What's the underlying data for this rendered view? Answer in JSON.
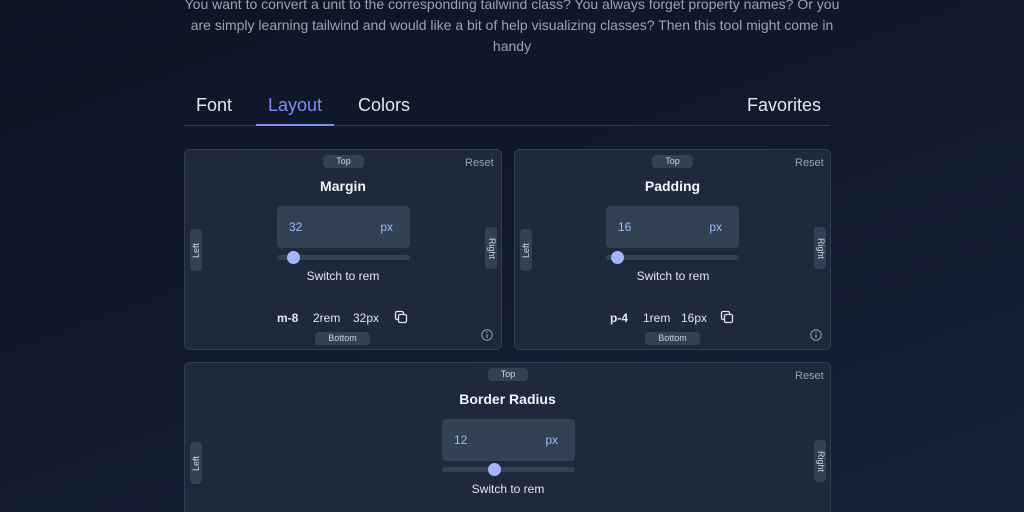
{
  "intro": {
    "line1": "You want to convert a unit to the corresponding tailwind class? You always forget property names? Or you",
    "line2": "are simply learning tailwind and would like a bit of help visualizing classes? Then this tool might come in",
    "line3": "handy"
  },
  "tabs": [
    {
      "label": "Font"
    },
    {
      "label": "Layout",
      "active": true
    },
    {
      "label": "Colors"
    },
    {
      "label": "Favorites"
    }
  ],
  "cards": {
    "margin": {
      "title": "Margin",
      "top": "Top",
      "bottom": "Bottom",
      "left": "Left",
      "right": "Right",
      "reset": "Reset",
      "value": "32",
      "unit": "px",
      "slider_fraction": 0.12,
      "switch_label": "Switch to rem",
      "class_name": "m-8",
      "rem": "2rem",
      "px": "32px"
    },
    "padding": {
      "title": "Padding",
      "top": "Top",
      "bottom": "Bottom",
      "left": "Left",
      "right": "Right",
      "reset": "Reset",
      "value": "16",
      "unit": "px",
      "slider_fraction": 0.08,
      "switch_label": "Switch to rem",
      "class_name": "p-4",
      "rem": "1rem",
      "px": "16px"
    },
    "radius": {
      "title": "Border Radius",
      "top": "Top",
      "left": "Left",
      "right": "Right",
      "reset": "Reset",
      "value": "12",
      "unit": "px",
      "slider_fraction": 0.39,
      "switch_label": "Switch to rem"
    }
  },
  "colors": {
    "accent": "#818cf8",
    "card": "#1e293b",
    "input": "#334155"
  },
  "icons": {
    "copy": "copy-icon",
    "info": "info-icon"
  }
}
